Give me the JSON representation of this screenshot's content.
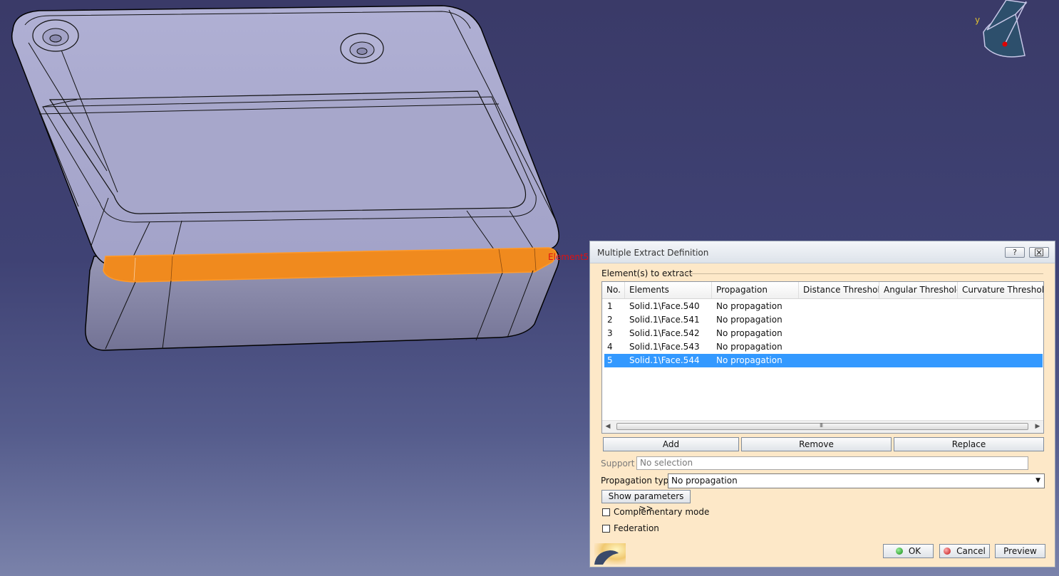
{
  "viewport": {
    "annotation": "Element5",
    "compass_axis": "y"
  },
  "dialog": {
    "title": "Multiple Extract Definition",
    "help_button": "?",
    "close_button": "☒",
    "group_label": "Element(s) to extract",
    "columns": [
      "No.",
      "Elements",
      "Propagation",
      "Distance Threshold",
      "Angular Threshold",
      "Curvature Threshold"
    ],
    "rows": [
      {
        "no": "1",
        "element": "Solid.1\\Face.540",
        "propagation": "No propagation"
      },
      {
        "no": "2",
        "element": "Solid.1\\Face.541",
        "propagation": "No propagation"
      },
      {
        "no": "3",
        "element": "Solid.1\\Face.542",
        "propagation": "No propagation"
      },
      {
        "no": "4",
        "element": "Solid.1\\Face.543",
        "propagation": "No propagation"
      },
      {
        "no": "5",
        "element": "Solid.1\\Face.544",
        "propagation": "No propagation"
      }
    ],
    "selected_row": 5,
    "scroll_grip": "III",
    "add_label": "Add",
    "remove_label": "Remove",
    "replace_label": "Replace",
    "support_label": "Support :",
    "support_placeholder": "No selection",
    "propagation_label": "Propagation type:",
    "propagation_value": "No propagation",
    "show_params_label": "Show parameters >>",
    "complementary_label": "Complementary mode",
    "complementary_checked": false,
    "federation_label": "Federation",
    "federation_checked": false,
    "ok_label": "OK",
    "cancel_label": "Cancel",
    "preview_label": "Preview"
  },
  "colors": {
    "selection": "#3399ff",
    "highlight_face": "#f08a1e",
    "dialog_bg": "#fde8c8",
    "part_face": "#a9a9cc"
  }
}
